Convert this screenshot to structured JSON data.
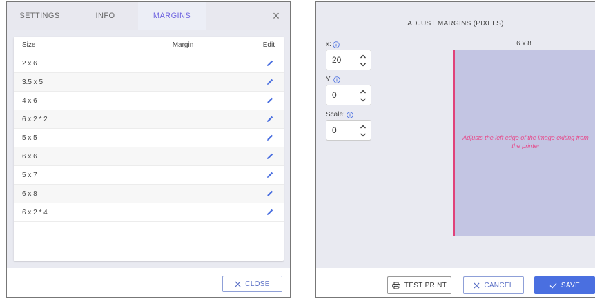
{
  "left_dialog": {
    "tabs": [
      {
        "label": "SETTINGS",
        "active": false
      },
      {
        "label": "INFO",
        "active": false
      },
      {
        "label": "MARGINS",
        "active": true
      }
    ],
    "close_symbol": "×",
    "table": {
      "headers": {
        "size": "Size",
        "margin": "Margin",
        "edit": "Edit"
      },
      "rows": [
        {
          "size": "2 x 6"
        },
        {
          "size": "3.5 x 5"
        },
        {
          "size": "4 x 6"
        },
        {
          "size": "6 x 2 * 2"
        },
        {
          "size": "5 x 5"
        },
        {
          "size": "6 x 6"
        },
        {
          "size": "5 x 7"
        },
        {
          "size": "6 x 8"
        },
        {
          "size": "6 x 2 * 4"
        }
      ]
    },
    "close_button_label": "CLOSE",
    "accent_color": "#6f64e0"
  },
  "right_dialog": {
    "title": "ADJUST MARGINS (PIXELS)",
    "fields": {
      "x": {
        "label": "x:",
        "value": "20"
      },
      "y": {
        "label": "Y:",
        "value": "0"
      },
      "scale": {
        "label": "Scale:",
        "value": "0"
      }
    },
    "preview": {
      "size_label": "6 x 8",
      "note": "Adjusts the left edge of the image exiting from the printer",
      "edge_color": "#e0427a",
      "fill_color": "#c3c5e3"
    },
    "buttons": {
      "test_print": "TEST PRINT",
      "cancel": "CANCEL",
      "save": "SAVE"
    },
    "primary_color": "#4a6fe0"
  }
}
